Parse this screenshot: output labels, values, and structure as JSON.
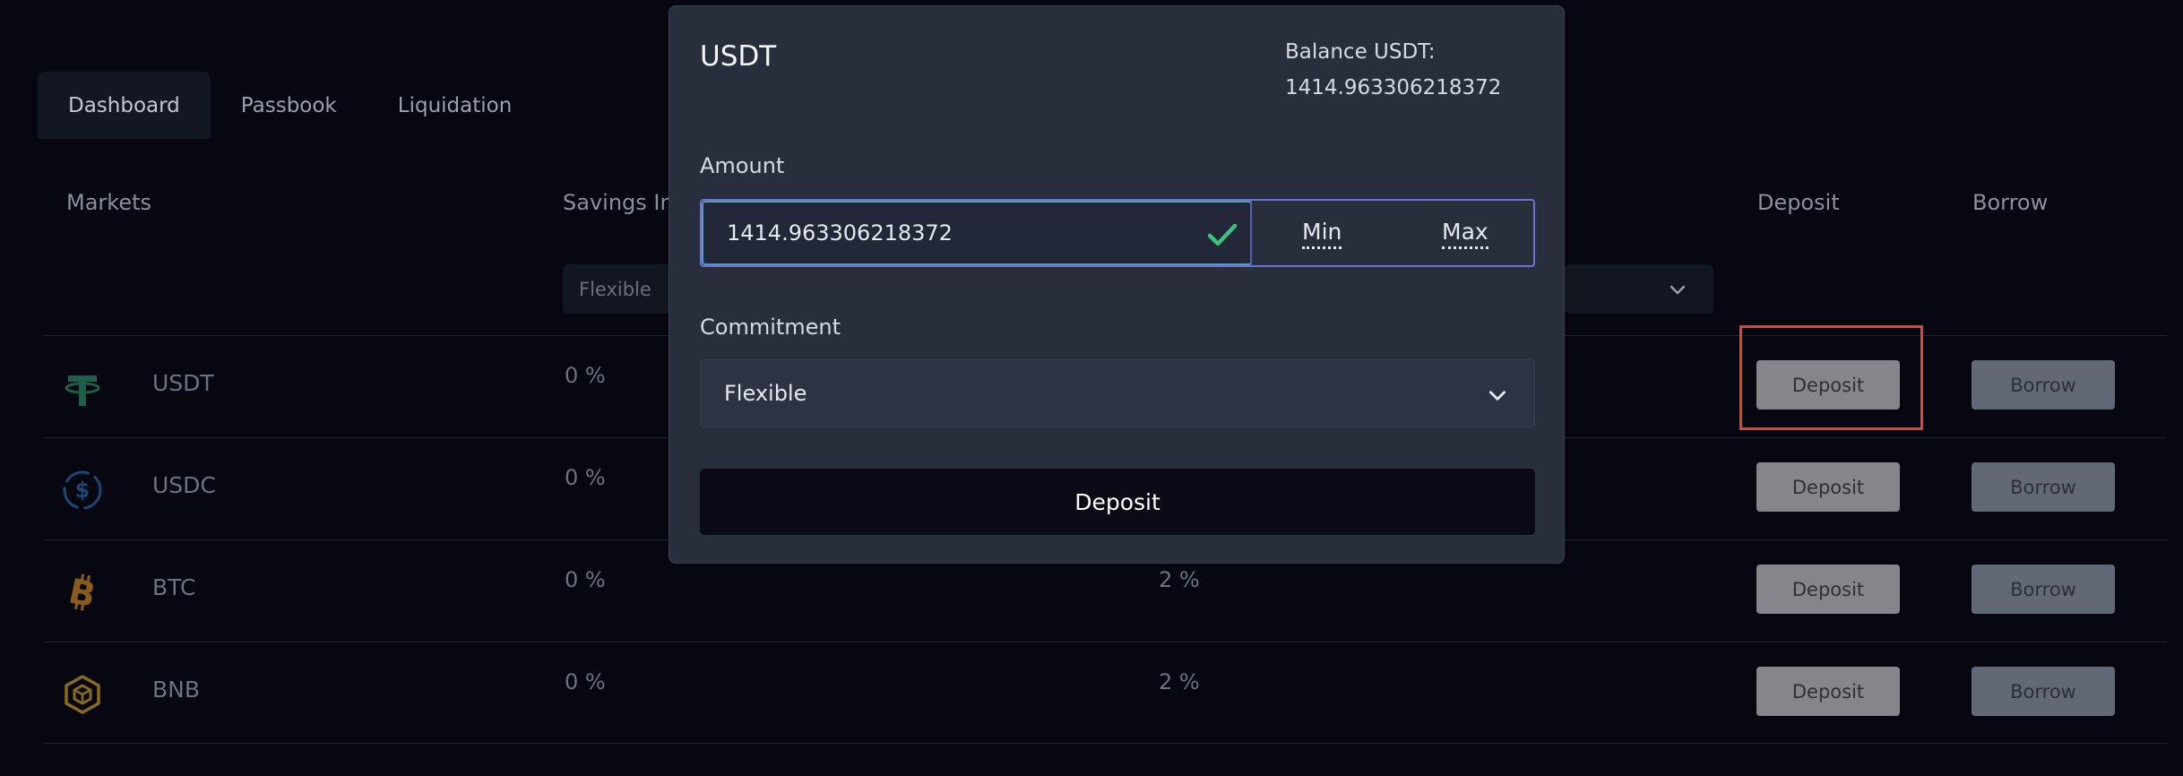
{
  "tabs": [
    "Dashboard",
    "Passbook",
    "Liquidation"
  ],
  "columns": {
    "markets": "Markets",
    "savings_interest": "Savings Int",
    "deposit": "Deposit",
    "borrow": "Borrow"
  },
  "filters": {
    "savings": "Flexible"
  },
  "rows": [
    {
      "coin": "USDT",
      "savings": "0 %",
      "borrow_rate": "",
      "deposit_label": "Deposit",
      "borrow_label": "Borrow"
    },
    {
      "coin": "USDC",
      "savings": "0 %",
      "borrow_rate": "",
      "deposit_label": "Deposit",
      "borrow_label": "Borrow"
    },
    {
      "coin": "BTC",
      "savings": "0 %",
      "borrow_rate": "2 %",
      "deposit_label": "Deposit",
      "borrow_label": "Borrow"
    },
    {
      "coin": "BNB",
      "savings": "0 %",
      "borrow_rate": "2 %",
      "deposit_label": "Deposit",
      "borrow_label": "Borrow"
    }
  ],
  "modal": {
    "title": "USDT",
    "balance_label": "Balance USDT:",
    "balance_value": "1414.963306218372",
    "amount_label": "Amount",
    "amount_value": "1414.963306218372",
    "min_label": "Min",
    "max_label": "Max",
    "commitment_label": "Commitment",
    "commitment_value": "Flexible",
    "submit_label": "Deposit"
  },
  "colors": {
    "background": "#060711",
    "modal_bg": "#292e3d",
    "accent_border": "#6d72d8",
    "valid_check": "#3fbf82",
    "highlight": "#e2452b",
    "usdt": "#26a17b",
    "usdc": "#2775ca",
    "btc": "#f7931a",
    "bnb": "#f3ba2f"
  },
  "icons": {
    "usdt": "tether-icon",
    "usdc": "usdc-icon",
    "btc": "bitcoin-icon",
    "bnb": "bnb-icon",
    "check": "check-icon",
    "chevron": "chevron-down-icon"
  }
}
